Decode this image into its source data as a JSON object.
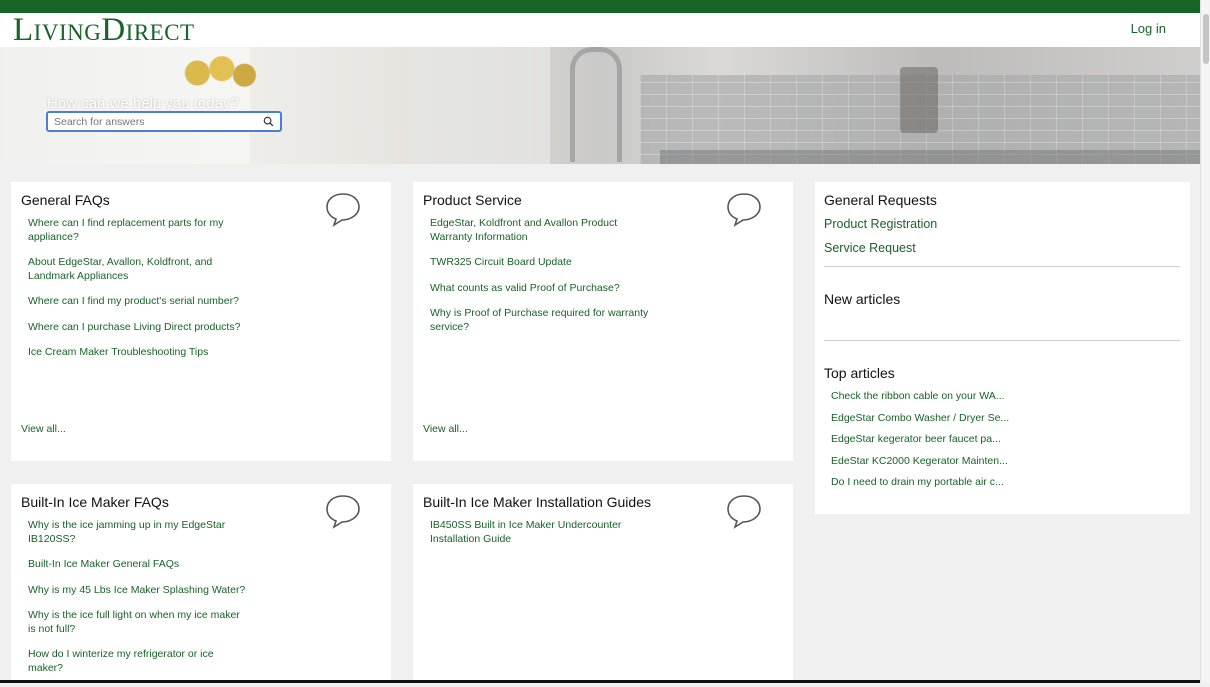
{
  "header": {
    "logo": "LivingDirect",
    "login": "Log in"
  },
  "hero": {
    "title": "How can we help you today?",
    "search_placeholder": "Search for answers"
  },
  "cards": [
    {
      "title": "General FAQs",
      "links": [
        "Where can I find replacement parts for my appliance?",
        "About EdgeStar, Avallon, Koldfront, and Landmark Appliances",
        "Where can I find my product's serial number?",
        "Where can I purchase Living Direct products?",
        "Ice Cream Maker Troubleshooting Tips"
      ],
      "view_all": "View all..."
    },
    {
      "title": "Product Service",
      "links": [
        "EdgeStar, Koldfront and Avallon Product Warranty Information",
        "TWR325 Circuit Board Update",
        "What counts as valid Proof of Purchase?",
        "Why is Proof of Purchase required for warranty service?"
      ],
      "view_all": "View all..."
    },
    {
      "title": "Built-In Ice Maker FAQs",
      "links": [
        "Why is the ice jamming up in my EdgeStar IB120SS?",
        "Built-In Ice Maker General FAQs",
        "Why is my 45 Lbs Ice Maker Splashing Water?",
        "Why is the ice full light on when my ice maker is not full?",
        "How do I winterize my refrigerator or ice maker?"
      ]
    },
    {
      "title": "Built-In Ice Maker Installation Guides",
      "links": [
        "IB450SS Built in Ice Maker Undercounter Installation Guide"
      ]
    }
  ],
  "sidebar": {
    "general_requests_title": "General Requests",
    "product_registration": "Product Registration",
    "service_request": "Service Request",
    "new_articles_title": "New articles",
    "top_articles_title": "Top articles",
    "top_articles": [
      "Check the ribbon cable on your WA...",
      "EdgeStar Combo Washer / Dryer Se...",
      "EdgeStar kegerator beer faucet pa...",
      "EdeStar KC2000 Kegerator Mainten...",
      "Do I need to drain my portable air c..."
    ]
  },
  "colors": {
    "brand_green": "#176427",
    "page_bg": "#f0f0f1",
    "search_focus": "#4a7fd6"
  }
}
